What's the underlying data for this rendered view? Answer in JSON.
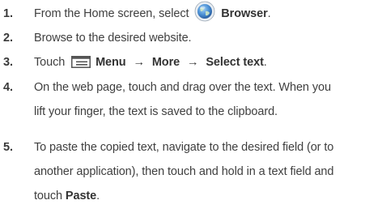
{
  "steps": [
    {
      "number": "1.",
      "pre": "From the Home screen, select",
      "icon": "browser-globe-icon",
      "bold": "Browser",
      "post": "."
    },
    {
      "number": "2.",
      "text": "Browse to the desired website."
    },
    {
      "number": "3.",
      "pre": "Touch",
      "icon": "menu-icon",
      "bold1": "Menu",
      "arrow1": "→",
      "bold2": "More",
      "arrow2": "→",
      "bold3": "Select text",
      "post": "."
    },
    {
      "number": "4.",
      "line1": "On the web page, touch and drag over the text. When you",
      "line2": "lift your finger, the text is saved to the clipboard."
    },
    {
      "number": "5.",
      "line1": "To paste the copied text, navigate to the desired field (or to",
      "line2": "another application), then touch and hold in a text field and",
      "pre3": "touch",
      "bold": "Paste",
      "post": "."
    }
  ],
  "colors": {
    "text": "#3f3f3f",
    "globe_blue": "#4a8fd4",
    "menu_gray": "#555555"
  }
}
